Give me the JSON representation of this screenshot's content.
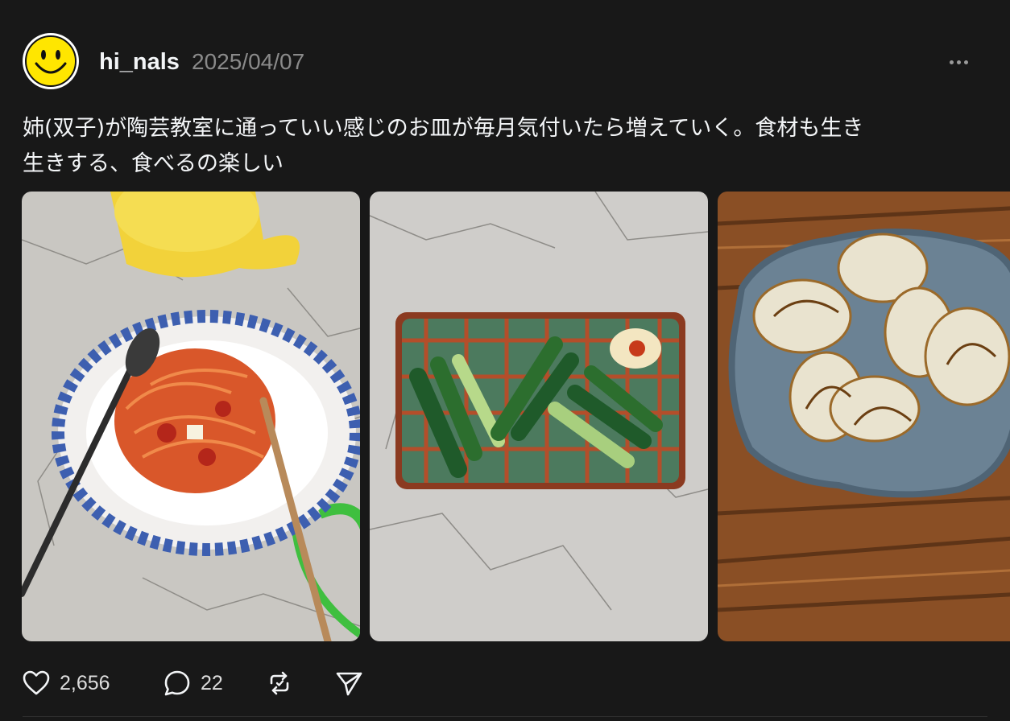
{
  "post": {
    "avatar_icon": "smiley-face-icon",
    "username": "hi_nals",
    "date": "2025/04/07",
    "caption": "姉(双子)が陶芸教室に通っていい感じのお皿が毎月気付いたら増えていく。食材も生き\n生きする、食べるの楽しい",
    "images": [
      {
        "name": "spaghetti-bowl-photo"
      },
      {
        "name": "cucumber-plate-photo"
      },
      {
        "name": "roasted-onion-plate-photo"
      }
    ]
  },
  "actions": {
    "likes": "2,656",
    "replies": "22",
    "like_icon": "heart-icon",
    "reply_icon": "speech-bubble-icon",
    "repost_icon": "repost-icon",
    "share_icon": "paper-plane-icon"
  },
  "colors": {
    "background": "#181818",
    "text": "#f3f5f7",
    "secondary": "#8a8a8a",
    "avatar_yellow": "#ffe600"
  }
}
